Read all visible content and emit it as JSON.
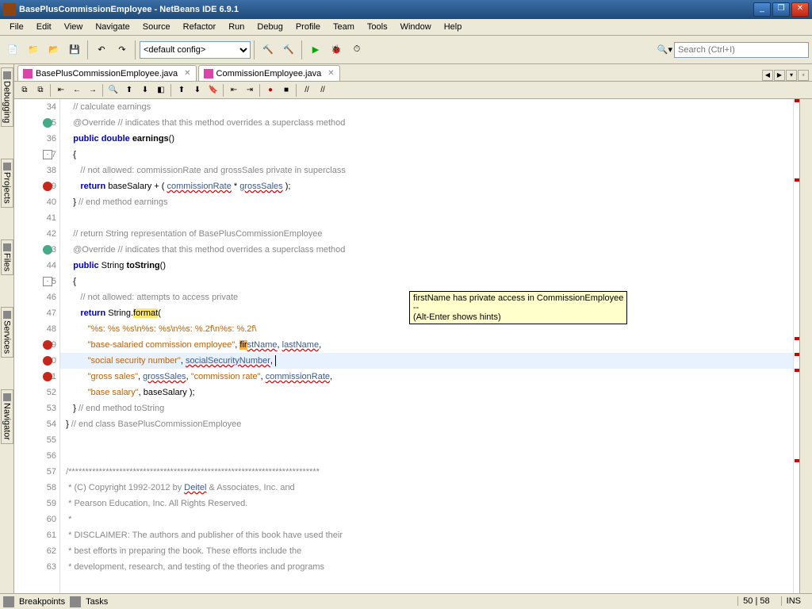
{
  "window": {
    "title": "BasePlusCommissionEmployee - NetBeans IDE 6.9.1"
  },
  "menu": {
    "items": [
      "File",
      "Edit",
      "View",
      "Navigate",
      "Source",
      "Refactor",
      "Run",
      "Debug",
      "Profile",
      "Team",
      "Tools",
      "Window",
      "Help"
    ]
  },
  "toolbar": {
    "config": "<default config>",
    "search_placeholder": "Search (Ctrl+I)"
  },
  "sidebar": {
    "tabs": [
      "Debugging",
      "Projects",
      "Files",
      "Services",
      "Navigator"
    ]
  },
  "tabs": {
    "items": [
      {
        "label": "BasePlusCommissionEmployee.java"
      },
      {
        "label": "CommissionEmployee.java"
      }
    ]
  },
  "tooltip": {
    "line1": "firstName has private access in CommissionEmployee",
    "line2": "--",
    "line3": "(Alt-Enter shows hints)"
  },
  "code": {
    "lines": [
      {
        "n": 34,
        "ind": "    ",
        "seg": [
          {
            "t": "// calculate earnings",
            "c": "cmt"
          }
        ]
      },
      {
        "n": 35,
        "ind": "    ",
        "g": "ovr",
        "seg": [
          {
            "t": "@Override",
            "c": "ann"
          },
          {
            "t": " "
          },
          {
            "t": "// indicates that this method overrides a superclass method",
            "c": "cmt"
          }
        ]
      },
      {
        "n": 36,
        "ind": "    ",
        "seg": [
          {
            "t": "public",
            "c": "kw"
          },
          {
            "t": " "
          },
          {
            "t": "double",
            "c": "kw"
          },
          {
            "t": " "
          },
          {
            "t": "earnings",
            "c": "bold"
          },
          {
            "t": "()"
          }
        ]
      },
      {
        "n": 37,
        "ind": "    ",
        "fold": true,
        "seg": [
          {
            "t": "{"
          }
        ]
      },
      {
        "n": 38,
        "ind": "       ",
        "seg": [
          {
            "t": "// not allowed: commissionRate and grossSales private in superclass",
            "c": "cmt"
          }
        ]
      },
      {
        "n": 39,
        "ind": "       ",
        "g": "err",
        "seg": [
          {
            "t": "return",
            "c": "kw"
          },
          {
            "t": " baseSalary + ( "
          },
          {
            "t": "commissionRate",
            "c": "err-u"
          },
          {
            "t": " * "
          },
          {
            "t": "grossSales",
            "c": "err-u"
          },
          {
            "t": " );"
          }
        ]
      },
      {
        "n": 40,
        "ind": "    ",
        "seg": [
          {
            "t": "} "
          },
          {
            "t": "// end method earnings",
            "c": "cmt"
          }
        ]
      },
      {
        "n": 41,
        "ind": "",
        "seg": []
      },
      {
        "n": 42,
        "ind": "    ",
        "seg": [
          {
            "t": "// return String representation of BasePlusCommissionEmployee",
            "c": "cmt"
          }
        ]
      },
      {
        "n": 43,
        "ind": "    ",
        "g": "ovr",
        "seg": [
          {
            "t": "@Override",
            "c": "ann"
          },
          {
            "t": " "
          },
          {
            "t": "// indicates that this method overrides a superclass method",
            "c": "cmt"
          }
        ]
      },
      {
        "n": 44,
        "ind": "    ",
        "seg": [
          {
            "t": "public",
            "c": "kw"
          },
          {
            "t": " String "
          },
          {
            "t": "toString",
            "c": "bold"
          },
          {
            "t": "()"
          }
        ]
      },
      {
        "n": 45,
        "ind": "    ",
        "fold": true,
        "seg": [
          {
            "t": "{"
          }
        ]
      },
      {
        "n": 46,
        "ind": "       ",
        "seg": [
          {
            "t": "// not allowed: attempts to access private",
            "c": "cmt"
          }
        ]
      },
      {
        "n": 47,
        "ind": "       ",
        "seg": [
          {
            "t": "return",
            "c": "kw"
          },
          {
            "t": " String."
          },
          {
            "t": "format",
            "c": "hly"
          },
          {
            "t": "("
          }
        ]
      },
      {
        "n": 48,
        "ind": "          ",
        "seg": [
          {
            "t": "\"%s: %s %s\\n%s: %s\\n%s: %.2f\\n%s: %.2f\\",
            "c": "str"
          }
        ]
      },
      {
        "n": 49,
        "ind": "          ",
        "g": "err",
        "seg": [
          {
            "t": "\"base-salaried commission employee\"",
            "c": "str"
          },
          {
            "t": ", "
          },
          {
            "t": "fi",
            "c": "hlo"
          },
          {
            "t": "r",
            "c": "hlo"
          },
          {
            "t": "stName",
            "c": "err-u"
          },
          {
            "t": ", "
          },
          {
            "t": "lastName",
            "c": "err-u"
          },
          {
            "t": ","
          }
        ]
      },
      {
        "n": 50,
        "ind": "          ",
        "g": "err",
        "hl": true,
        "seg": [
          {
            "t": "\"social security number\"",
            "c": "str"
          },
          {
            "t": ", "
          },
          {
            "t": "socialSecurityNumber",
            "c": "err-u"
          },
          {
            "t": ", "
          },
          {
            "cursor": true
          }
        ]
      },
      {
        "n": 51,
        "ind": "          ",
        "g": "err",
        "seg": [
          {
            "t": "\"gross sales\"",
            "c": "str"
          },
          {
            "t": ", "
          },
          {
            "t": "grossSales",
            "c": "err-u"
          },
          {
            "t": ", "
          },
          {
            "t": "\"commission rate\"",
            "c": "str"
          },
          {
            "t": ", "
          },
          {
            "t": "commissionRate",
            "c": "err-u"
          },
          {
            "t": ","
          }
        ]
      },
      {
        "n": 52,
        "ind": "          ",
        "seg": [
          {
            "t": "\"base salary\"",
            "c": "str"
          },
          {
            "t": ", baseSalary );"
          }
        ]
      },
      {
        "n": 53,
        "ind": "    ",
        "seg": [
          {
            "t": "} "
          },
          {
            "t": "// end method toString",
            "c": "cmt"
          }
        ]
      },
      {
        "n": 54,
        "ind": " ",
        "seg": [
          {
            "t": "} "
          },
          {
            "t": "// end class BasePlusCommissionEmployee",
            "c": "cmt"
          }
        ]
      },
      {
        "n": 55,
        "ind": "",
        "seg": []
      },
      {
        "n": 56,
        "ind": "",
        "seg": []
      },
      {
        "n": 57,
        "ind": " ",
        "seg": [
          {
            "t": "/**************************************************************************",
            "c": "cmt"
          }
        ]
      },
      {
        "n": 58,
        "ind": "  ",
        "seg": [
          {
            "t": "* (C) Copyright 1992-2012 by ",
            "c": "cmt"
          },
          {
            "t": "Deitel",
            "c": "cmt err-u"
          },
          {
            "t": " & Associates, Inc. and",
            "c": "cmt"
          }
        ]
      },
      {
        "n": 59,
        "ind": "  ",
        "seg": [
          {
            "t": "* Pearson Education, Inc. All Rights Reserved.",
            "c": "cmt"
          }
        ]
      },
      {
        "n": 60,
        "ind": "  ",
        "seg": [
          {
            "t": "*",
            "c": "cmt"
          }
        ]
      },
      {
        "n": 61,
        "ind": "  ",
        "seg": [
          {
            "t": "* DISCLAIMER: The authors and publisher of this book have used their",
            "c": "cmt"
          }
        ]
      },
      {
        "n": 62,
        "ind": "  ",
        "seg": [
          {
            "t": "* best efforts in preparing the book. These efforts include the",
            "c": "cmt"
          }
        ]
      },
      {
        "n": 63,
        "ind": "  ",
        "seg": [
          {
            "t": "* development, research, and testing of the theories and programs",
            "c": "cmt"
          }
        ]
      }
    ]
  },
  "bottom": {
    "items": [
      "Breakpoints",
      "Tasks"
    ]
  },
  "status": {
    "line": "50",
    "col": "58",
    "mode": "INS"
  }
}
